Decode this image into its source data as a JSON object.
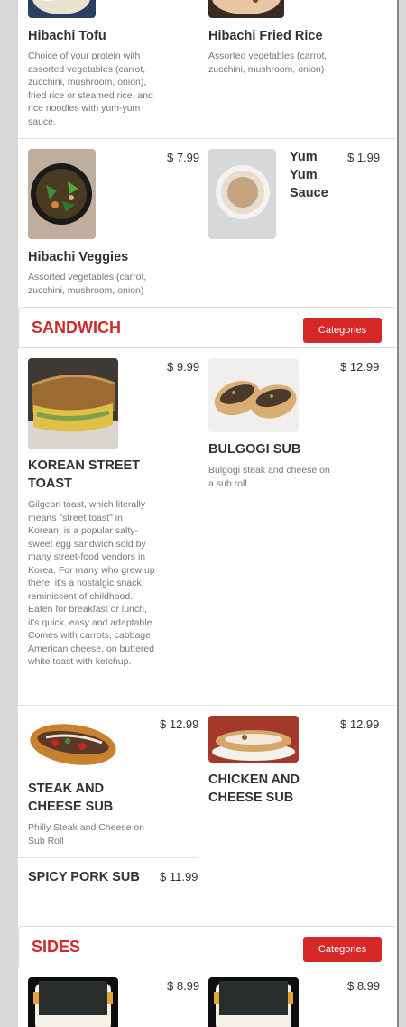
{
  "items_top": {
    "tofu": {
      "name": "Hibachi Tofu",
      "desc": "Choice of your protein with assorted vegetables (carrot, zucchini, mushroom, onion), fried rice or steamed rice, and rice noodles with yum-yum sauce."
    },
    "fried_rice": {
      "name": "Hibachi Fried Rice",
      "desc": "Assorted vegetables (carrot, zucchini, mushroom, onion)"
    },
    "veggies": {
      "name": "Hibachi Veggies",
      "price": "$ 7.99",
      "desc": "Assorted vegetables (carrot, zucchini, mushroom, onion)"
    },
    "yum_yum": {
      "name": "Yum Yum Sauce",
      "price": "$ 1.99"
    }
  },
  "sandwich": {
    "title": "SANDWICH",
    "button": "Categories",
    "items": {
      "korean_toast": {
        "name": "KOREAN STREET TOAST",
        "price": "$ 9.99",
        "desc": "Gilgeori toast, which literally means \"street toast\" in Korean, is a popular salty-sweet egg sandwich sold by many street-food vendors in Korea. For many who grew up there, it's a nostalgic snack, reminiscent of childhood. Eaten for breakfast or lunch, it's quick, easy and adaptable. Comes with carrots, cabbage, American cheese, on buttered white toast with ketchup."
      },
      "bulgogi": {
        "name": "BULGOGI SUB",
        "price": "$ 12.99",
        "desc": "Bulgogi steak and cheese on a sub roll"
      },
      "steak_cheese": {
        "name": "STEAK AND CHEESE SUB",
        "price": "$ 12.99",
        "desc": "Philly Steak and Cheese on Sub Roll"
      },
      "chicken_cheese": {
        "name": "CHICKEN AND CHEESE SUB",
        "price": "$ 12.99"
      },
      "spicy_pork": {
        "name": "SPICY PORK SUB",
        "price": "$ 11.99"
      }
    }
  },
  "sides": {
    "title": "SIDES",
    "button": "Categories",
    "items": {
      "side1": {
        "price": "$ 8.99"
      },
      "side2": {
        "price": "$ 8.99"
      }
    }
  },
  "colors": {
    "accent": "#d62828",
    "title_red": "#cf2b2b"
  }
}
